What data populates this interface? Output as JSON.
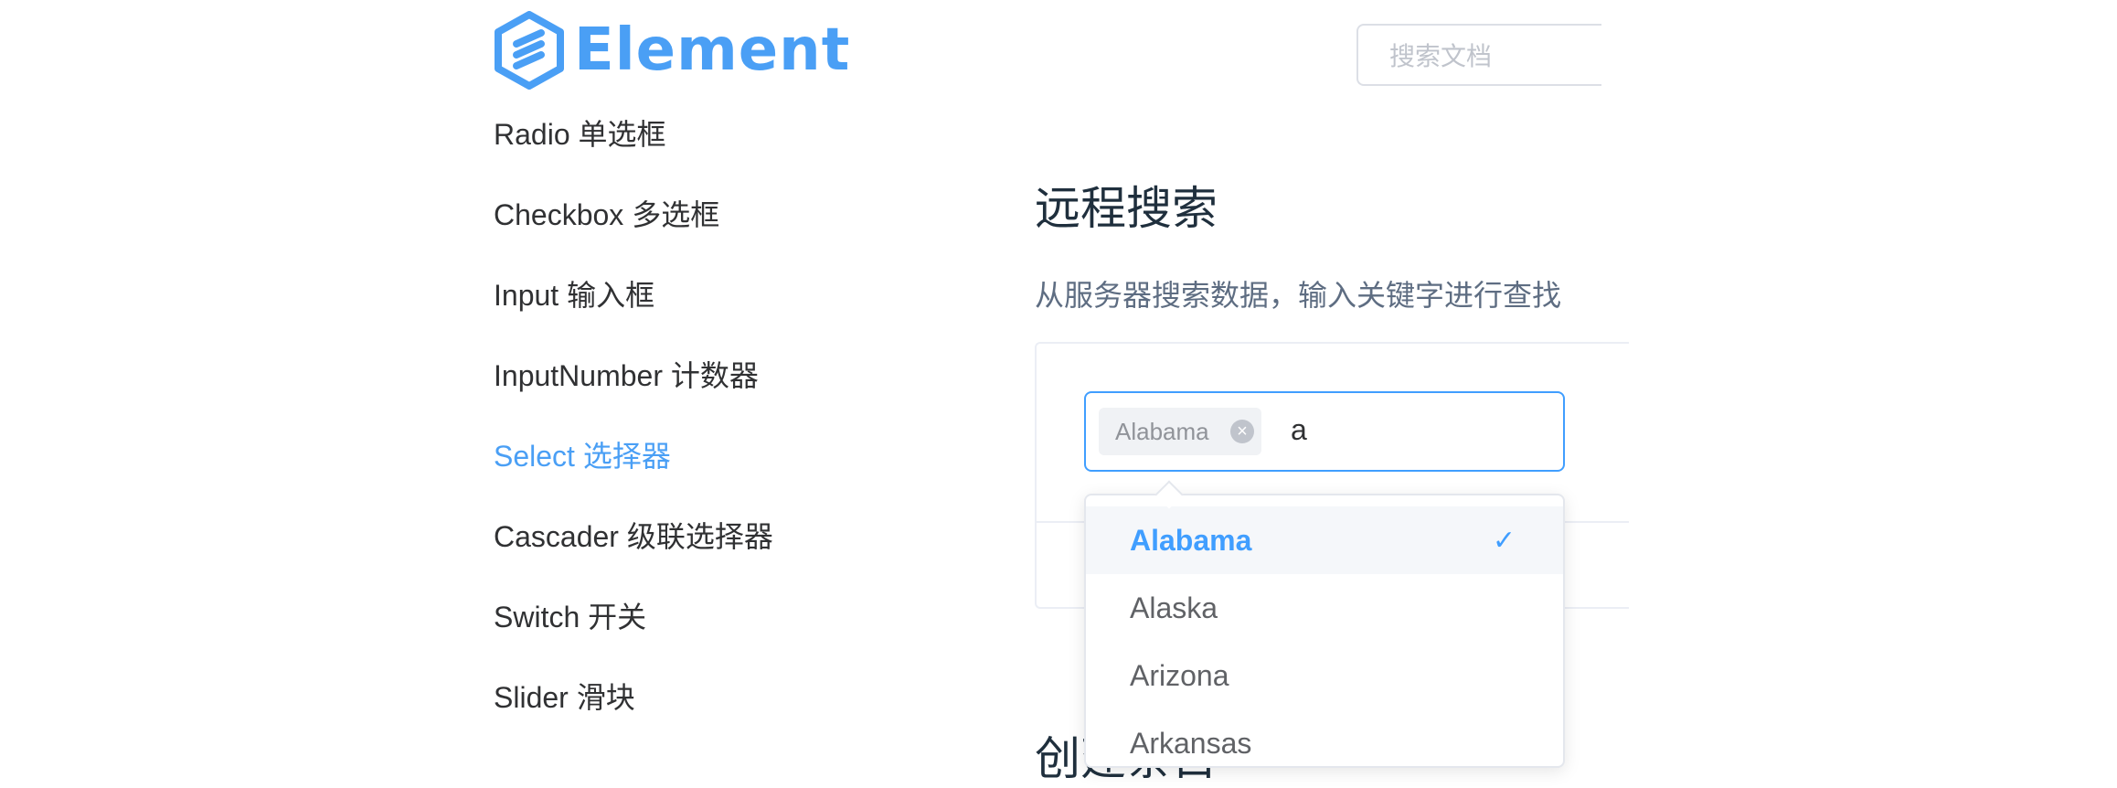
{
  "header": {
    "logo_text": "Element",
    "search_placeholder": "搜索文档"
  },
  "sidebar": {
    "items": [
      {
        "label": "Radio 单选框",
        "active": false
      },
      {
        "label": "Checkbox 多选框",
        "active": false
      },
      {
        "label": "Input 输入框",
        "active": false
      },
      {
        "label": "InputNumber 计数器",
        "active": false
      },
      {
        "label": "Select 选择器",
        "active": true
      },
      {
        "label": "Cascader 级联选择器",
        "active": false
      },
      {
        "label": "Switch 开关",
        "active": false
      },
      {
        "label": "Slider 滑块",
        "active": false
      }
    ]
  },
  "main": {
    "section_title": "远程搜索",
    "section_desc": "从服务器搜索数据，输入关键字进行查找",
    "next_section_title": "创建条目"
  },
  "select": {
    "tags": [
      {
        "label": "Alabama"
      }
    ],
    "query": "a",
    "options": [
      {
        "label": "Alabama",
        "selected": true
      },
      {
        "label": "Alaska",
        "selected": false
      },
      {
        "label": "Arizona",
        "selected": false
      },
      {
        "label": "Arkansas",
        "selected": false
      }
    ]
  },
  "colors": {
    "brand": "#409EFF",
    "logo": "#4A9FF5",
    "text_primary": "#303133",
    "text_secondary": "#5E6D82",
    "border": "#DCDFE6"
  }
}
